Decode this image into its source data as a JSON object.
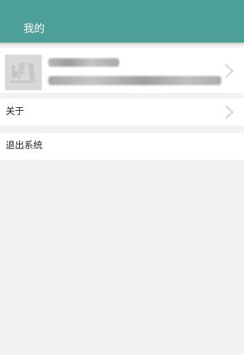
{
  "header": {
    "title": "我的"
  },
  "profile": {
    "avatar_icon": "placeholder-avatar-icon",
    "chevron_icon": "chevron-right-icon"
  },
  "menu": {
    "about_label": "关于",
    "logout_label": "退出系统",
    "chevron_icon": "chevron-right-icon"
  },
  "colors": {
    "header_bg": "#4d9f9a",
    "page_bg": "#f2f2f2",
    "row_bg": "#ffffff"
  }
}
